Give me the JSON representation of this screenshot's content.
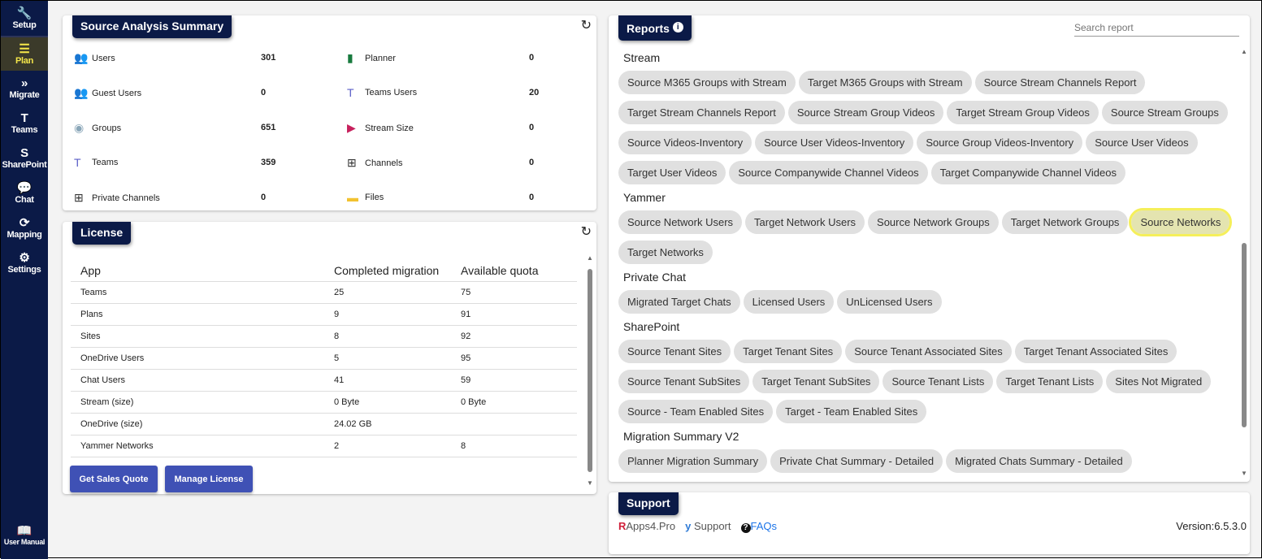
{
  "sidebar": {
    "items": [
      {
        "label": "Setup",
        "icon": "wrench-icon"
      },
      {
        "label": "Plan",
        "icon": "list-icon"
      },
      {
        "label": "Migrate",
        "icon": "chevrons-icon"
      },
      {
        "label": "Teams",
        "icon": "teams-icon"
      },
      {
        "label": "SharePoint",
        "icon": "sharepoint-icon"
      },
      {
        "label": "Chat",
        "icon": "chat-icon"
      },
      {
        "label": "Mapping",
        "icon": "sync-icon"
      },
      {
        "label": "Settings",
        "icon": "gear-icon"
      }
    ],
    "user_manual": "User Manual",
    "active": "Plan"
  },
  "summary": {
    "title": "Source Analysis Summary",
    "left": [
      {
        "label": "Users",
        "value": "301"
      },
      {
        "label": "Guest Users",
        "value": "0"
      },
      {
        "label": "Groups",
        "value": "651"
      },
      {
        "label": "Teams",
        "value": "359"
      },
      {
        "label": "Private Channels",
        "value": "0"
      }
    ],
    "right": [
      {
        "label": "Planner",
        "value": "0"
      },
      {
        "label": "Teams Users",
        "value": "20"
      },
      {
        "label": "Stream Size",
        "value": "0"
      },
      {
        "label": "Channels",
        "value": "0"
      },
      {
        "label": "Files",
        "value": "0"
      }
    ]
  },
  "license": {
    "title": "License",
    "headers": [
      "App",
      "Completed migration",
      "Available quota"
    ],
    "rows": [
      [
        "Teams",
        "25",
        "75"
      ],
      [
        "Plans",
        "9",
        "91"
      ],
      [
        "Sites",
        "8",
        "92"
      ],
      [
        "OneDrive Users",
        "5",
        "95"
      ],
      [
        "Chat Users",
        "41",
        "59"
      ],
      [
        "Stream (size)",
        "0 Byte",
        "0 Byte"
      ],
      [
        "OneDrive (size)",
        "24.02 GB",
        ""
      ],
      [
        "Yammer Networks",
        "2",
        "8"
      ]
    ],
    "buttons": [
      "Get Sales Quote",
      "Manage License"
    ]
  },
  "reports": {
    "title": "Reports",
    "search_placeholder": "Search report",
    "highlighted": "Source Networks",
    "sections": [
      {
        "name": "Stream",
        "rows": [
          [
            "Source M365 Groups with Stream",
            "Target M365 Groups with Stream",
            "Source Stream Channels Report"
          ],
          [
            "Target Stream Channels Report",
            "Source Stream Group Videos",
            "Target Stream Group Videos",
            "Source Stream Groups"
          ],
          [
            "Source Videos-Inventory",
            "Source User Videos-Inventory",
            "Source Group Videos-Inventory",
            "Source User Videos"
          ],
          [
            "Target User Videos",
            "Source Companywide Channel Videos",
            "Target Companywide Channel Videos"
          ]
        ]
      },
      {
        "name": "Yammer",
        "rows": [
          [
            "Source Network Users",
            "Target Network Users",
            "Source Network Groups",
            "Target Network Groups",
            "Source Networks"
          ],
          [
            "Target Networks"
          ]
        ]
      },
      {
        "name": "Private Chat",
        "rows": [
          [
            "Migrated Target Chats",
            "Licensed Users",
            "UnLicensed Users"
          ]
        ]
      },
      {
        "name": "SharePoint",
        "rows": [
          [
            "Source Tenant Sites",
            "Target Tenant Sites",
            "Source Tenant Associated Sites",
            "Target Tenant Associated Sites"
          ],
          [
            "Source Tenant SubSites",
            "Target Tenant SubSites",
            "Source Tenant Lists",
            "Target Tenant Lists",
            "Sites Not Migrated"
          ],
          [
            "Source - Team Enabled Sites",
            "Target - Team Enabled Sites"
          ]
        ]
      },
      {
        "name": "Migration Summary V2",
        "rows": [
          [
            "Planner Migration Summary",
            "Private Chat Summary - Detailed",
            "Migrated Chats Summary - Detailed"
          ]
        ]
      }
    ]
  },
  "support": {
    "title": "Support",
    "links": [
      "Apps4.Pro",
      "Support",
      "FAQs"
    ],
    "version": "Version:6.5.3.0"
  }
}
